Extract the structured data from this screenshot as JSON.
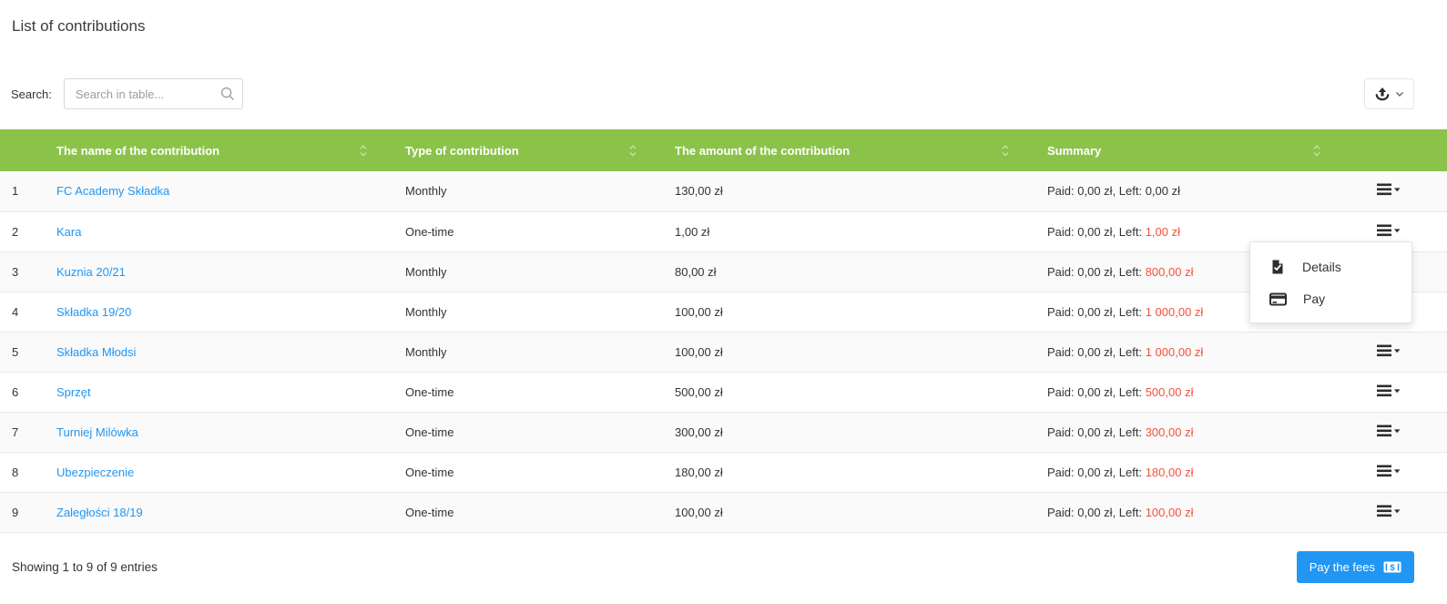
{
  "page": {
    "title": "List of contributions"
  },
  "search": {
    "label": "Search:",
    "placeholder": "Search in table...",
    "icon": "search-icon"
  },
  "export_button": {
    "icon": "export-icon",
    "chevron_icon": "chevron-down-icon"
  },
  "table": {
    "columns": [
      "The name of the contribution",
      "Type of contribution",
      "The amount of the contribution",
      "Summary"
    ],
    "summary_labels": {
      "paid": "Paid: ",
      "left": ", Left: "
    },
    "rows": [
      {
        "index": "1",
        "name": "FC Academy Składka",
        "type": "Monthly",
        "amount": "130,00 zł",
        "paid": "0,00 zł",
        "left": "0,00 zł",
        "left_red": false
      },
      {
        "index": "2",
        "name": "Kara",
        "type": "One-time",
        "amount": "1,00 zł",
        "paid": "0,00 zł",
        "left": "1,00 zł",
        "left_red": true
      },
      {
        "index": "3",
        "name": "Kuznia 20/21",
        "type": "Monthly",
        "amount": "80,00 zł",
        "paid": "0,00 zł",
        "left": "800,00 zł",
        "left_red": true
      },
      {
        "index": "4",
        "name": "Składka 19/20",
        "type": "Monthly",
        "amount": "100,00 zł",
        "paid": "0,00 zł",
        "left": "1 000,00 zł",
        "left_red": true
      },
      {
        "index": "5",
        "name": "Składka Młodsi",
        "type": "Monthly",
        "amount": "100,00 zł",
        "paid": "0,00 zł",
        "left": "1 000,00 zł",
        "left_red": true
      },
      {
        "index": "6",
        "name": "Sprzęt",
        "type": "One-time",
        "amount": "500,00 zł",
        "paid": "0,00 zł",
        "left": "500,00 zł",
        "left_red": true
      },
      {
        "index": "7",
        "name": "Turniej Milówka",
        "type": "One-time",
        "amount": "300,00 zł",
        "paid": "0,00 zł",
        "left": "300,00 zł",
        "left_red": true
      },
      {
        "index": "8",
        "name": "Ubezpieczenie",
        "type": "One-time",
        "amount": "180,00 zł",
        "paid": "0,00 zł",
        "left": "180,00 zł",
        "left_red": true
      },
      {
        "index": "9",
        "name": "Zaległości 18/19",
        "type": "One-time",
        "amount": "100,00 zł",
        "paid": "0,00 zł",
        "left": "100,00 zł",
        "left_red": true
      }
    ]
  },
  "row_menu": {
    "items": [
      {
        "label": "Details",
        "icon": "document-check-icon"
      },
      {
        "label": "Pay",
        "icon": "credit-card-icon"
      }
    ]
  },
  "footer": {
    "showing": "Showing 1 to 9 of 9 entries",
    "pay_button_label": "Pay the fees",
    "pay_button_icon": "banknote-icon"
  },
  "colors": {
    "header_green": "#8bc34a",
    "link_blue": "#2196f3",
    "alert_red": "#f4513c",
    "button_blue": "#2196f3"
  }
}
